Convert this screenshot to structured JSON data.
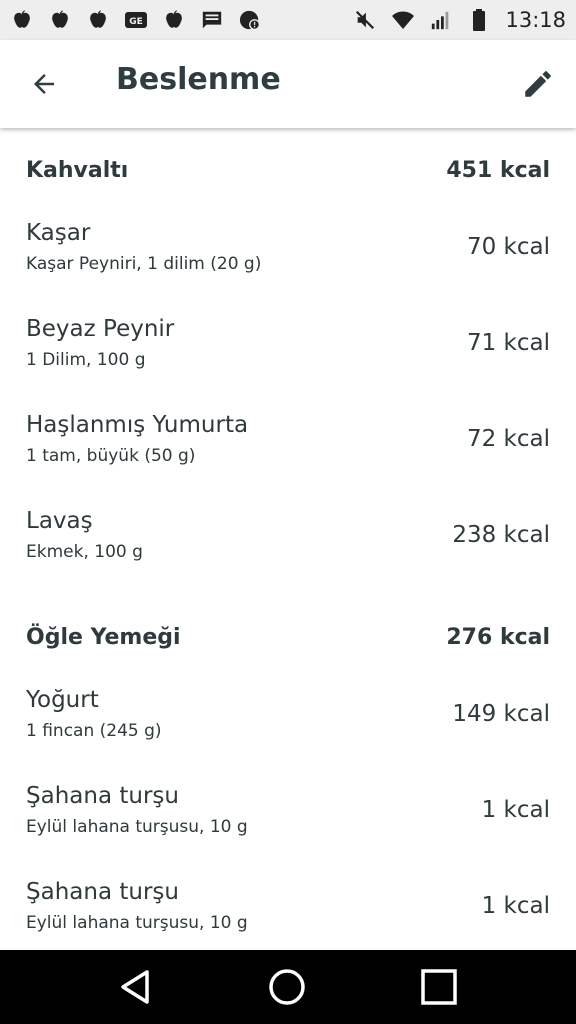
{
  "status_bar": {
    "time": "13:18",
    "left_icons": [
      "apple-icon",
      "apple-icon",
      "apple-icon",
      "ge-icon",
      "apple-icon",
      "message-icon",
      "alert-icon"
    ],
    "right_icons": [
      "mute-icon",
      "wifi-icon",
      "signal-icon",
      "battery-icon"
    ]
  },
  "app_bar": {
    "title": "Beslenme",
    "back_icon": "arrow-back-icon",
    "edit_icon": "pencil-icon"
  },
  "sections": [
    {
      "title": "Kahvaltı",
      "total": "451 kcal",
      "items": [
        {
          "name": "Kaşar",
          "desc": "Kaşar Peyniri, 1 dilim (20 g)",
          "kcal": "70 kcal"
        },
        {
          "name": "Beyaz Peynir",
          "desc": "1 Dilim, 100 g",
          "kcal": "71 kcal"
        },
        {
          "name": "Haşlanmış Yumurta",
          "desc": "1 tam, büyük (50 g)",
          "kcal": "72 kcal"
        },
        {
          "name": "Lavaş",
          "desc": "Ekmek, 100 g",
          "kcal": "238 kcal"
        }
      ]
    },
    {
      "title": "Öğle Yemeği",
      "total": "276 kcal",
      "items": [
        {
          "name": "Yoğurt",
          "desc": "1 fincan (245 g)",
          "kcal": "149 kcal"
        },
        {
          "name": "Şahana turşu",
          "desc": "Eylül lahana turşusu, 10 g",
          "kcal": "1 kcal"
        },
        {
          "name": "Şahana turşu",
          "desc": "Eylül lahana turşusu, 10 g",
          "kcal": "1 kcal"
        }
      ]
    }
  ],
  "nav_bar": {
    "icons": [
      "back-triangle-icon",
      "home-circle-icon",
      "recents-square-icon"
    ]
  }
}
